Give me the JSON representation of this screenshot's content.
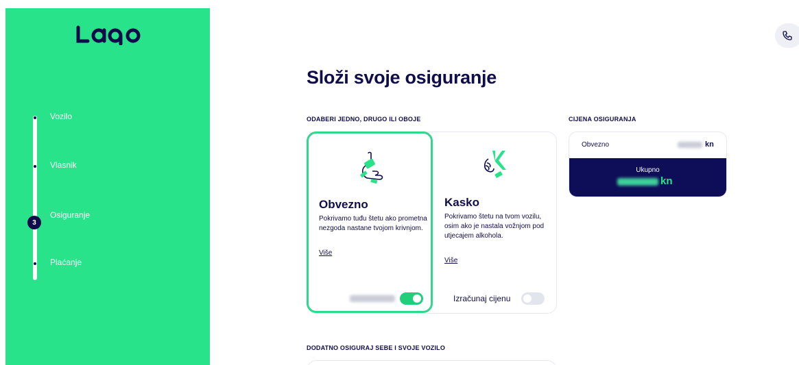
{
  "sidebar": {
    "logo_text": "LAQO",
    "steps": [
      {
        "label": "Vozilo"
      },
      {
        "label": "Vlasnik"
      },
      {
        "label": "Osiguranje",
        "number": "3"
      },
      {
        "label": "Plaćanje"
      }
    ]
  },
  "header": {
    "phone_icon": "phone-icon"
  },
  "main": {
    "title": "Složi svoje osiguranje",
    "choose_label": "ODABERI JEDNO, DRUGO ILI OBOJE",
    "price_label": "CIJENA OSIGURANJA",
    "extra_label": "DODATNO OSIGURAJ SEBE I SVOJE VOZILO",
    "cards": [
      {
        "title": "Obvezno",
        "description": "Pokrivamo tuđu štetu ako prometna nezgoda nastane tvojom krivnjom.",
        "more": "Više",
        "toggle_on": true,
        "icon": "hand-pointer-icon"
      },
      {
        "title": "Kasko",
        "description": "Pokrivamo štetu na tvom vozilu, osim ako je nastala vožnjom pod utjecajem alkohola.",
        "more": "Više",
        "calc_label": "Izračunaj cijenu",
        "toggle_on": false,
        "icon": "hand-k-icon"
      }
    ],
    "price": {
      "row_label": "Obvezno",
      "row_currency": "kn",
      "total_label": "Ukupno",
      "total_currency": "kn"
    }
  },
  "colors": {
    "brand_green": "#28e38a",
    "navy": "#0e0d58",
    "toggle_on": "#1fcf7c",
    "toggle_off": "#e3e5ec"
  }
}
